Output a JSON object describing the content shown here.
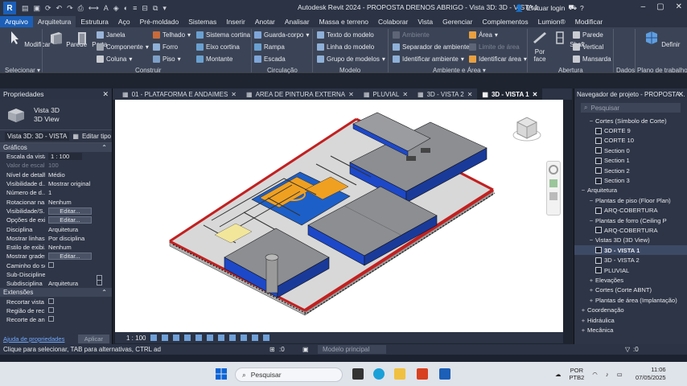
{
  "titlebar": {
    "app_title": "Autodesk Revit 2024 - PROPOSTA DRENOS ABRIGO - Vista 3D: 3D - VISTA 1",
    "login": "Efetuar login",
    "logo": "R"
  },
  "tabs": [
    "Arquivo",
    "Arquitetura",
    "Estrutura",
    "Aço",
    "Pré-moldado",
    "Sistemas",
    "Inserir",
    "Anotar",
    "Analisar",
    "Massa e terreno",
    "Colaborar",
    "Vista",
    "Gerenciar",
    "Complementos",
    "Lumion®",
    "Modificar"
  ],
  "ribbon": {
    "select": {
      "modify": "Modificar",
      "panel": "Selecionar ▾"
    },
    "construct": {
      "parede": "Parede",
      "porta": "Porta",
      "janela": "Janela",
      "componente": "Componente",
      "coluna": "Coluna",
      "telhado": "Telhado",
      "forro": "Forro",
      "piso": "Piso",
      "sistema_cortina": "Sistema cortina",
      "eixo_cortina": "Eixo cortina",
      "montante": "Montante",
      "panel": "Construir"
    },
    "circulation": {
      "guarda_corpo": "Guarda-corpo",
      "rampa": "Rampa",
      "escada": "Escada",
      "panel": "Circulação"
    },
    "model": {
      "texto": "Texto do modelo",
      "linha": "Linha do modelo",
      "grupo": "Grupo de modelos",
      "panel": "Modelo"
    },
    "room": {
      "ambiente": "Ambiente",
      "separador": "Separador de ambiente",
      "identificar": "Identificar ambiente",
      "area": "Área",
      "limite_area": "Limite de área",
      "identificar_area": "Identificar área",
      "panel": "Ambiente e Área ▾"
    },
    "opening": {
      "por_face": "Por\nface",
      "shaft": "Shaft",
      "parede": "Parede",
      "vertical": "Vertical",
      "mansarda": "Mansarda",
      "panel": "Abertura"
    },
    "datum": {
      "panel": "Dados"
    },
    "workplane": {
      "definir": "Definir",
      "panel": "Plano de trabalho"
    }
  },
  "properties": {
    "title": "Propriedades",
    "type_name_1": "Vista 3D",
    "type_name_2": "3D View",
    "instance": "Vista 3D: 3D - VISTA",
    "edit_type": "Editar tipo",
    "group_graphics": "Gráficos",
    "rows": [
      {
        "k": "Escala da vista",
        "v": "1 : 100",
        "dim": false,
        "box": true
      },
      {
        "k": "Valor de escal...",
        "v": "100",
        "dim": true
      },
      {
        "k": "Nível de detalhe",
        "v": "Médio"
      },
      {
        "k": "Visibilidade d...",
        "v": "Mostrar original"
      },
      {
        "k": "Número de d...",
        "v": "1"
      },
      {
        "k": "Rotacionar na...",
        "v": "Nenhum"
      },
      {
        "k": "Visibilidade/S...",
        "v": "Editar...",
        "btn": true
      },
      {
        "k": "Opções de exi...",
        "v": "Editar...",
        "btn": true
      },
      {
        "k": "Disciplina",
        "v": "Arquitetura"
      },
      {
        "k": "Mostrar linhas...",
        "v": "Por disciplina"
      },
      {
        "k": "Estilo de exibi...",
        "v": "Nenhum"
      },
      {
        "k": "Mostrar grades",
        "v": "Editar...",
        "btn": true
      },
      {
        "k": "Caminho do sol",
        "v": "",
        "chk": true
      },
      {
        "k": "Sub-Discipline",
        "v": "",
        "chk2": true
      },
      {
        "k": "Subdisciplina",
        "v": "Arquitetura",
        "chk2": true
      }
    ],
    "group_extents": "Extensões",
    "rows2": [
      {
        "k": "Recortar vista",
        "v": "",
        "chk": true
      },
      {
        "k": "Região de rec...",
        "v": "",
        "chk": true
      },
      {
        "k": "Recorte de an...",
        "v": "",
        "chk": true
      }
    ],
    "help_link": "Ajuda de propriedades",
    "apply": "Aplicar"
  },
  "view_tabs": [
    {
      "label": "01 - PLATAFORMA E ANDAIMES",
      "active": false
    },
    {
      "label": "AREA DE PINTURA EXTERNA",
      "active": false
    },
    {
      "label": "PLUVIAL",
      "active": false
    },
    {
      "label": "3D - VISTA 2",
      "active": false
    },
    {
      "label": "3D - VISTA 1",
      "active": true
    }
  ],
  "view_scale": "1 : 100",
  "navigator": {
    "title": "Navegador de projeto - PROPOSTA...",
    "search_placeholder": "Pesquisar",
    "items": [
      {
        "label": "Cortes (Símbolo de Corte)",
        "indent": 2,
        "pm": "−"
      },
      {
        "label": "CORTE 9",
        "indent": 3,
        "view": true
      },
      {
        "label": "CORTE 10",
        "indent": 3,
        "view": true
      },
      {
        "label": "Section 0",
        "indent": 3,
        "view": true
      },
      {
        "label": "Section 1",
        "indent": 3,
        "view": true
      },
      {
        "label": "Section 2",
        "indent": 3,
        "view": true
      },
      {
        "label": "Section 3",
        "indent": 3,
        "view": true
      },
      {
        "label": "Arquitetura",
        "indent": 1,
        "pm": "−"
      },
      {
        "label": "Plantas de piso (Floor Plan)",
        "indent": 2,
        "pm": "−"
      },
      {
        "label": "ARQ-COBERTURA",
        "indent": 3,
        "view": true
      },
      {
        "label": "Plantas de forro (Ceiling P",
        "indent": 2,
        "pm": "−"
      },
      {
        "label": "ARQ-COBERTURA",
        "indent": 3,
        "view": true
      },
      {
        "label": "Vistas 3D (3D View)",
        "indent": 2,
        "pm": "−"
      },
      {
        "label": "3D - VISTA 1",
        "indent": 3,
        "view": true,
        "bold": true,
        "sel": true
      },
      {
        "label": "3D - VISTA 2",
        "indent": 3,
        "view": true
      },
      {
        "label": "PLUVIAL",
        "indent": 3,
        "view": true
      },
      {
        "label": "Elevações",
        "indent": 2,
        "pm": "+"
      },
      {
        "label": "Cortes (Corte ABNT)",
        "indent": 2,
        "pm": "+"
      },
      {
        "label": "Plantas de área (Implantação)",
        "indent": 2,
        "pm": "+"
      },
      {
        "label": "Coordenação",
        "indent": 1,
        "pm": "+"
      },
      {
        "label": "Hidráulica",
        "indent": 1,
        "pm": "+"
      },
      {
        "label": "Mecânica",
        "indent": 1,
        "pm": "+"
      }
    ]
  },
  "statusbar": {
    "message": "Clique para selecionar, TAB para alternativas, CTRL adici",
    "workset": ":0",
    "model": "Modelo principal",
    "filter": ":0"
  },
  "taskbar": {
    "search": "Pesquisar",
    "lang_1": "POR",
    "lang_2": "PTB2",
    "time": "11:06",
    "date": "07/05/2025"
  },
  "colors": {
    "accent": "#1b5fb8",
    "ribbon": "#3b4456",
    "panel": "#2e3546",
    "roof_blue": "#1d48c8",
    "roof_gray": "#8c8e92",
    "wall_red": "#c22020",
    "floor_orange": "#f0a020"
  }
}
